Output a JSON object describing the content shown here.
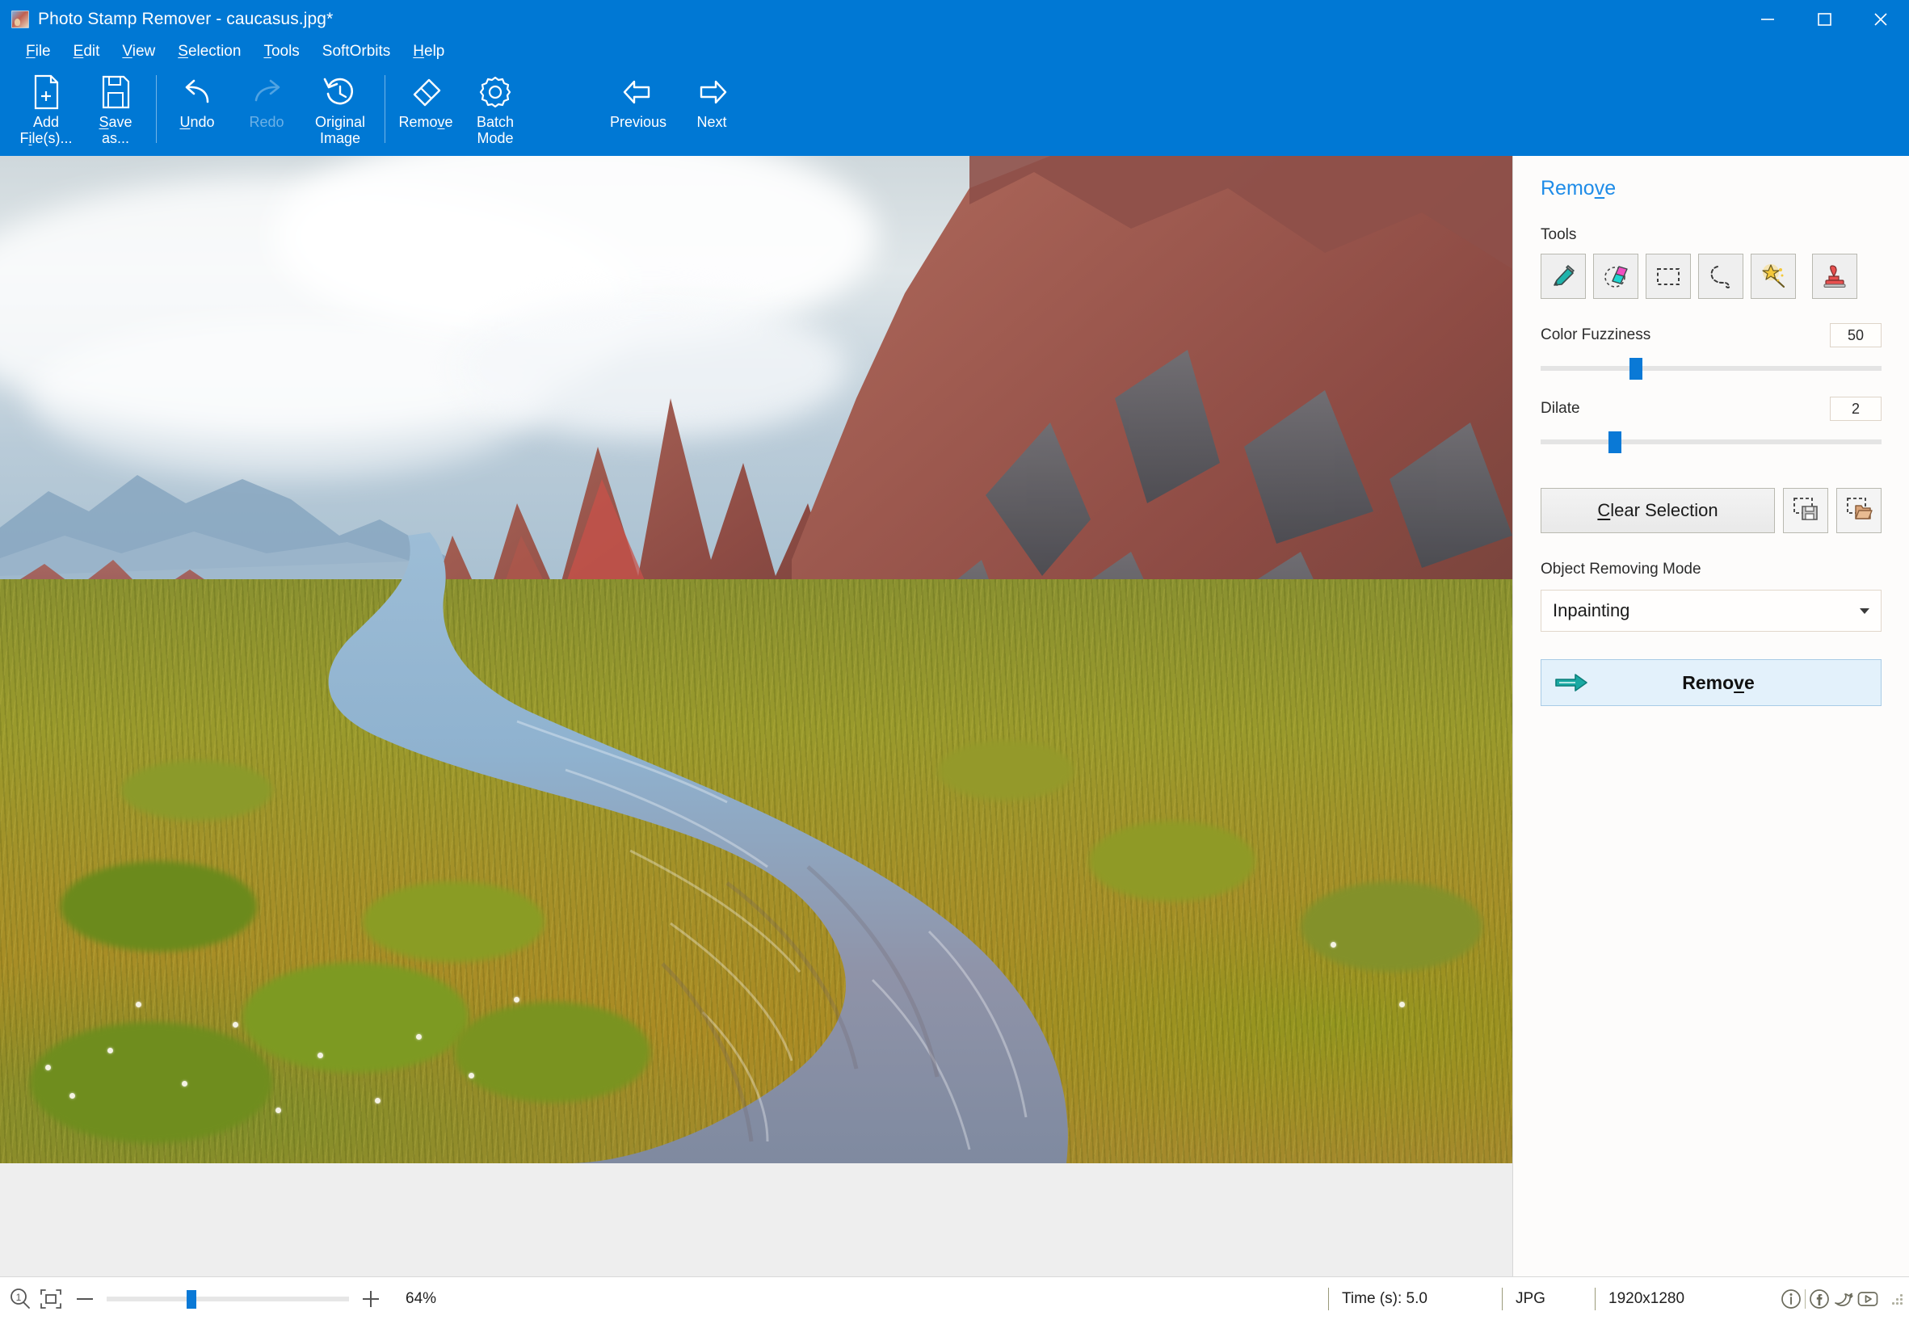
{
  "window": {
    "title": "Photo Stamp Remover - caucasus.jpg*",
    "app_icon": "photo-stamp-remover-icon",
    "accent_color": "#0078d4",
    "controls": {
      "minimize": "minimize-icon",
      "maximize": "maximize-icon",
      "close": "close-icon"
    }
  },
  "menubar": {
    "items": [
      {
        "label": "File",
        "mnemonic": "F"
      },
      {
        "label": "Edit",
        "mnemonic": "E"
      },
      {
        "label": "View",
        "mnemonic": "V"
      },
      {
        "label": "Selection",
        "mnemonic": "S"
      },
      {
        "label": "Tools",
        "mnemonic": "T"
      },
      {
        "label": "SoftOrbits",
        "mnemonic": ""
      },
      {
        "label": "Help",
        "mnemonic": "H"
      }
    ]
  },
  "ribbon": {
    "buttons": [
      {
        "label": "Add\nFile(s)...",
        "icon": "add-file-icon",
        "enabled": true
      },
      {
        "label": "Save\nas...",
        "icon": "save-icon",
        "enabled": true
      },
      {
        "label": "Undo",
        "icon": "undo-icon",
        "enabled": true
      },
      {
        "label": "Redo",
        "icon": "redo-icon",
        "enabled": false
      },
      {
        "label": "Original\nImage",
        "icon": "history-clock-icon",
        "enabled": true
      },
      {
        "label": "Remove",
        "icon": "eraser-icon",
        "enabled": true
      },
      {
        "label": "Batch\nMode",
        "icon": "gear-icon",
        "enabled": true
      },
      {
        "label": "Previous",
        "icon": "arrow-left-icon",
        "enabled": true
      },
      {
        "label": "Next",
        "icon": "arrow-right-icon",
        "enabled": true
      }
    ]
  },
  "panel": {
    "heading": "Remove",
    "tools_label": "Tools",
    "tools": [
      {
        "name": "marker-tool",
        "icon": "marker-icon",
        "selected": false
      },
      {
        "name": "eraser-tool",
        "icon": "eraser-color-icon",
        "selected": false
      },
      {
        "name": "rectangle-select-tool",
        "icon": "rectangle-select-icon",
        "selected": false
      },
      {
        "name": "lasso-select-tool",
        "icon": "lasso-icon",
        "selected": false
      },
      {
        "name": "magic-wand-tool",
        "icon": "magic-wand-icon",
        "selected": false
      },
      {
        "name": "clone-stamp-tool",
        "icon": "stamp-icon",
        "selected": false
      }
    ],
    "color_fuzziness": {
      "label": "Color Fuzziness",
      "value": "50",
      "percent": 26
    },
    "dilate": {
      "label": "Dilate",
      "value": "2",
      "percent": 20
    },
    "clear_selection_label": "Clear Selection",
    "save_selection_icon": "save-selection-icon",
    "load_selection_icon": "load-selection-icon",
    "object_removing_mode_label": "Object Removing Mode",
    "object_removing_mode_value": "Inpainting",
    "remove_button_label": "Remove",
    "remove_button_icon": "arrow-right-teal-icon"
  },
  "statusbar": {
    "zoom_search_icon": "zoom-1-to-1-icon",
    "fit_icon": "fit-to-window-icon",
    "zoom_out_icon": "minus-icon",
    "zoom_in_icon": "plus-icon",
    "zoom_percent": "64%",
    "zoom_slider_percent": 33,
    "time": "Time (s): 5.0",
    "format": "JPG",
    "dimensions": "1920x1280",
    "social": [
      {
        "name": "info-icon",
        "glyph": "i"
      },
      {
        "name": "facebook-icon",
        "glyph": "f"
      },
      {
        "name": "twitter-icon",
        "glyph": "t"
      },
      {
        "name": "youtube-icon",
        "glyph": "y"
      }
    ]
  },
  "image": {
    "file_name": "caucasus.jpg",
    "description": "Mountain valley with red rocky cliffs, alpine meadow and winding stream"
  }
}
